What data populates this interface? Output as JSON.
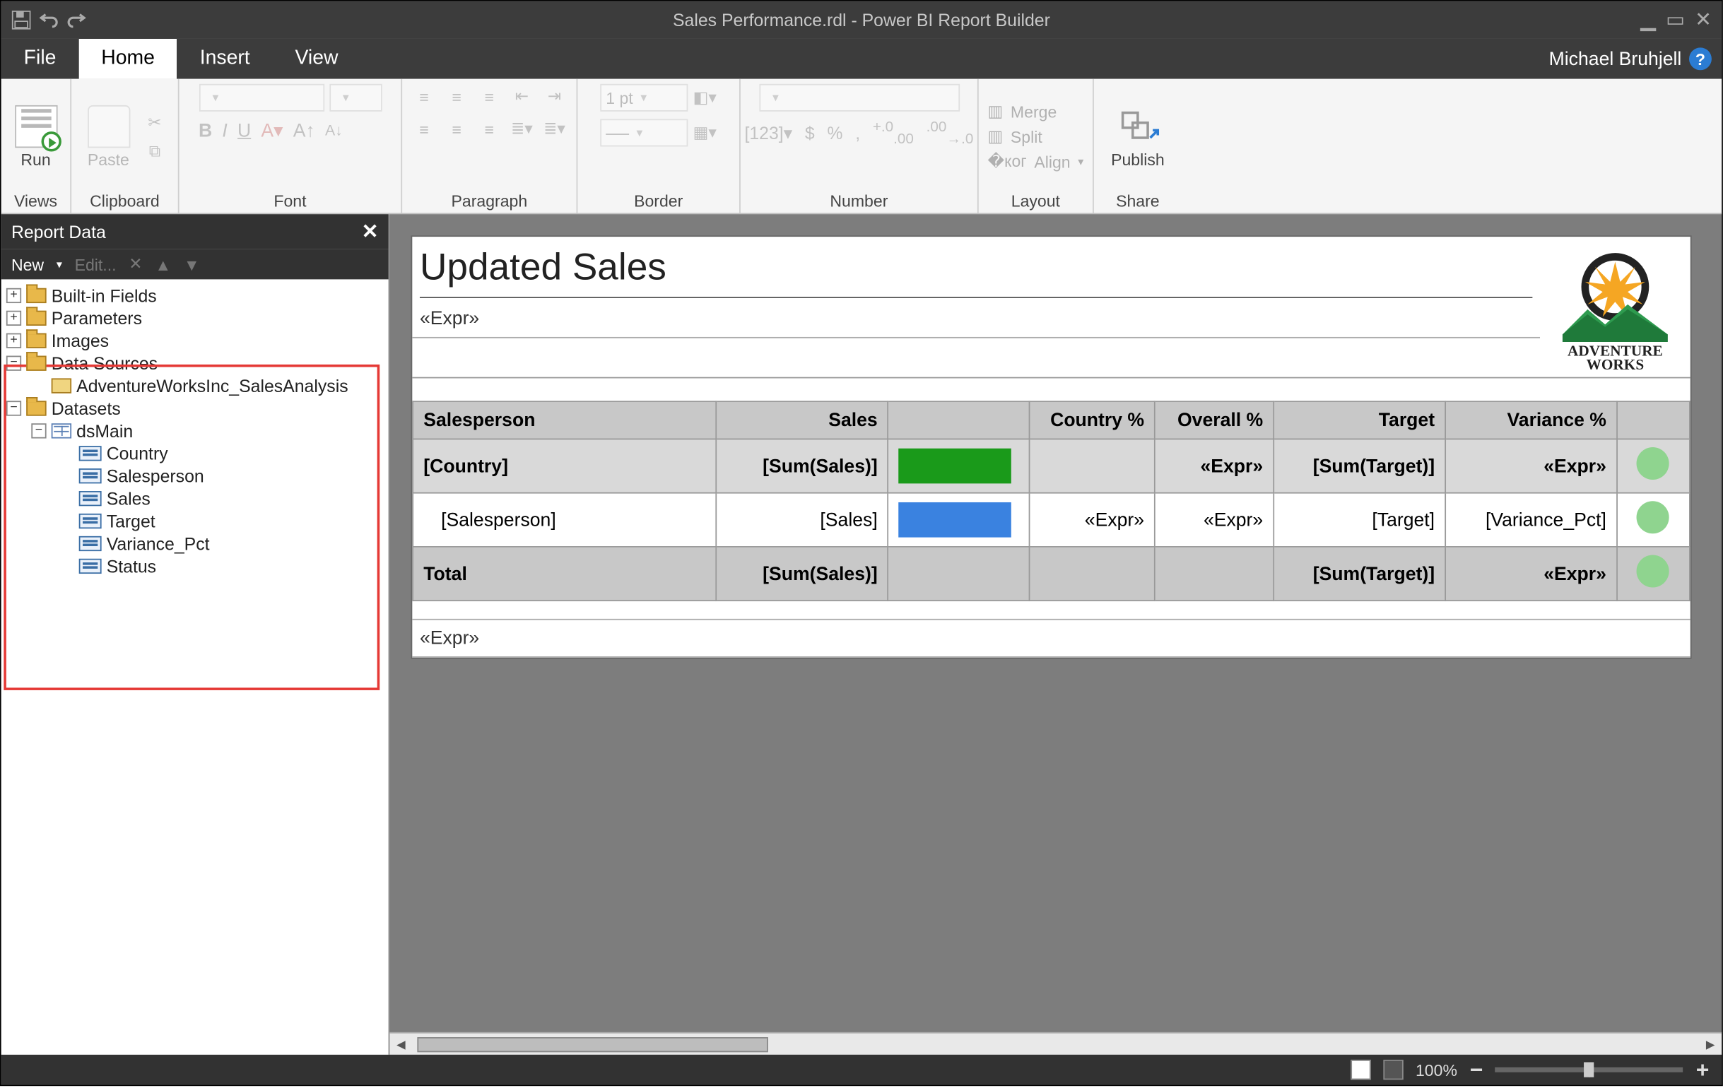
{
  "title": "Sales Performance.rdl - Power BI Report Builder",
  "user": "Michael Bruhjell",
  "menu": {
    "file": "File",
    "home": "Home",
    "insert": "Insert",
    "view": "View"
  },
  "ribbon": {
    "run": "Run",
    "paste": "Paste",
    "border_width": "1 pt",
    "merge": "Merge",
    "split": "Split",
    "align": "Align",
    "publish": "Publish",
    "groups": {
      "views": "Views",
      "clipboard": "Clipboard",
      "font": "Font",
      "paragraph": "Paragraph",
      "border": "Border",
      "number": "Number",
      "layout": "Layout",
      "share": "Share"
    }
  },
  "pane": {
    "title": "Report Data",
    "new": "New",
    "edit": "Edit...",
    "nodes": {
      "builtin": "Built-in Fields",
      "parameters": "Parameters",
      "images": "Images",
      "datasources": "Data Sources",
      "ds_item": "AdventureWorksInc_SalesAnalysis",
      "datasets": "Datasets",
      "dsmain": "dsMain",
      "fields": [
        "Country",
        "Salesperson",
        "Sales",
        "Target",
        "Variance_Pct",
        "Status"
      ]
    }
  },
  "report": {
    "title": "Updated Sales",
    "expr": "«Expr»",
    "logo_text_top": "ADVENTURE",
    "logo_text_bottom": "WORKS",
    "headers": [
      "Salesperson",
      "Sales",
      "",
      "Country %",
      "Overall %",
      "Target",
      "Variance %",
      ""
    ],
    "row_country": [
      "[Country]",
      "[Sum(Sales)]",
      "",
      "",
      "«Expr»",
      "[Sum(Target)]",
      "«Expr»",
      ""
    ],
    "row_detail": [
      "[Salesperson]",
      "[Sales]",
      "",
      "«Expr»",
      "«Expr»",
      "[Target]",
      "[Variance_Pct]",
      ""
    ],
    "row_total": [
      "Total",
      "[Sum(Sales)]",
      "",
      "",
      "",
      "[Sum(Target)]",
      "«Expr»",
      ""
    ],
    "footer": "«Expr»"
  },
  "status": {
    "zoom": "100%"
  }
}
